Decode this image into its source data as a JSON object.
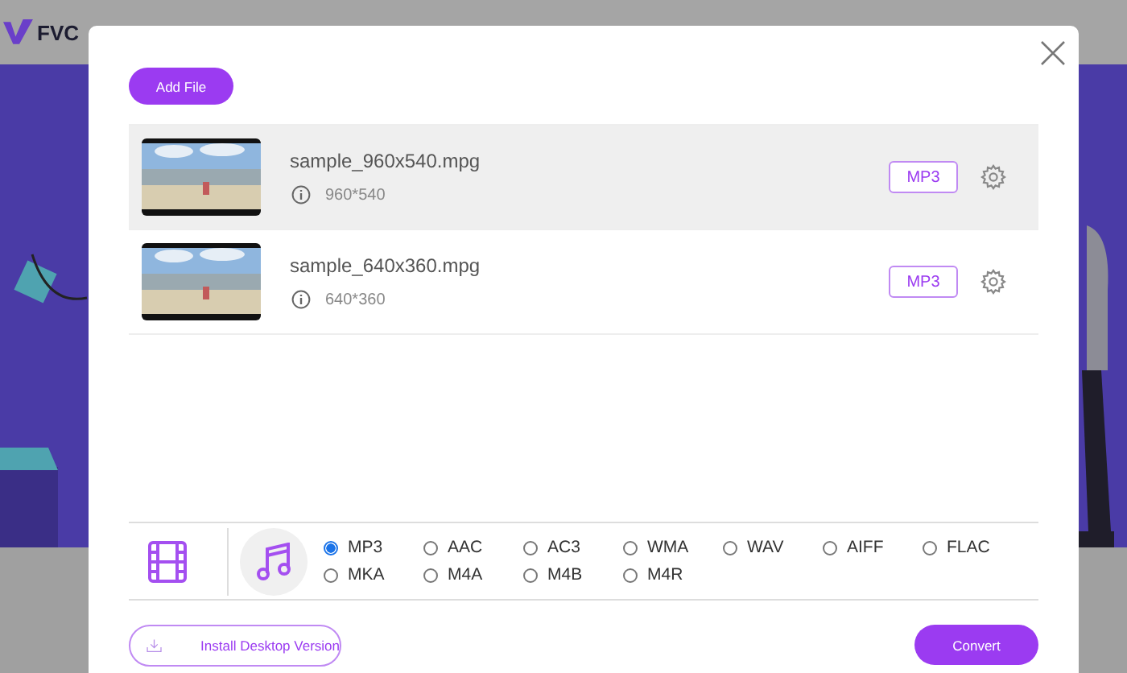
{
  "site": {
    "logo": "FVC"
  },
  "dialog": {
    "add_button": "Add File",
    "files": [
      {
        "name": "sample_960x540.mpg",
        "resolution": "960*540",
        "format": "MP3",
        "selected": true
      },
      {
        "name": "sample_640x360.mpg",
        "resolution": "640*360",
        "format": "MP3",
        "selected": false
      }
    ],
    "tabs": [
      {
        "kind": "video",
        "selected": false
      },
      {
        "kind": "audio",
        "selected": true
      }
    ],
    "formats": [
      {
        "label": "MP3",
        "selected": true
      },
      {
        "label": "AAC",
        "selected": false
      },
      {
        "label": "AC3",
        "selected": false
      },
      {
        "label": "WMA",
        "selected": false
      },
      {
        "label": "WAV",
        "selected": false
      },
      {
        "label": "AIFF",
        "selected": false
      },
      {
        "label": "FLAC",
        "selected": false
      },
      {
        "label": "MKA",
        "selected": false
      },
      {
        "label": "M4A",
        "selected": false
      },
      {
        "label": "M4B",
        "selected": false
      },
      {
        "label": "M4R",
        "selected": false
      }
    ],
    "install_button": "Install Desktop Version",
    "convert_button": "Convert"
  }
}
